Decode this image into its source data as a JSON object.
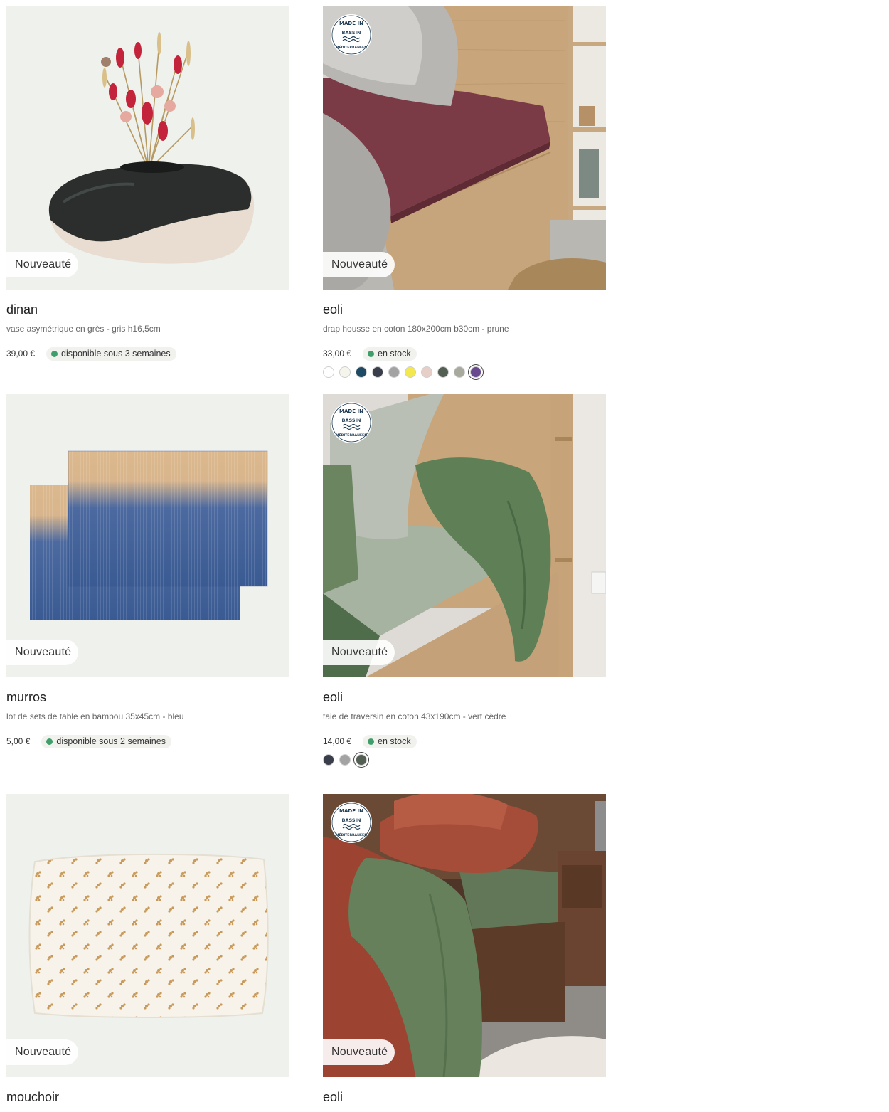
{
  "products": [
    {
      "name": "dinan",
      "description": "vase asymétrique en grès - gris h16,5cm",
      "badge": "Nouveauté",
      "price": "39,00 €",
      "availability": "disponible sous 3 semaines",
      "availability_color": "#3f9f6a",
      "made_in_seal": false,
      "image": "vase-with-dried-flowers",
      "swatches": []
    },
    {
      "name": "eoli",
      "description": "drap housse en coton 180x200cm b30cm - prune",
      "badge": "Nouveauté",
      "price": "33,00 €",
      "availability": "en stock",
      "availability_color": "#3f9f6a",
      "made_in_seal": true,
      "seal_text": [
        "MADE IN",
        "BASSIN",
        "MÉDITERRANÉEN"
      ],
      "image": "bed-fitted-sheet-plum",
      "swatches": [
        {
          "color": "#ffffff",
          "selected": false
        },
        {
          "color": "#f6f5ec",
          "selected": false
        },
        {
          "color": "#1e4a63",
          "selected": false
        },
        {
          "color": "#3a3d4a",
          "selected": false
        },
        {
          "color": "#a3a3a3",
          "selected": false
        },
        {
          "color": "#f3e84e",
          "selected": false
        },
        {
          "color": "#e7cfc8",
          "selected": false
        },
        {
          "color": "#535f52",
          "selected": false
        },
        {
          "color": "#a7aa9c",
          "selected": false
        },
        {
          "color": "#6a4a8f",
          "selected": true
        }
      ]
    },
    {
      "name": "murros",
      "description": "lot de sets de table en bambou 35x45cm - bleu",
      "badge": "Nouveauté",
      "price": "5,00 €",
      "availability": "disponible sous 2 semaines",
      "availability_color": "#3f9f6a",
      "made_in_seal": false,
      "image": "bamboo-placemats-blue",
      "swatches": []
    },
    {
      "name": "eoli",
      "description": "taie de traversin en coton 43x190cm - vert cèdre",
      "badge": "Nouveauté",
      "price": "14,00 €",
      "availability": "en stock",
      "availability_color": "#3f9f6a",
      "made_in_seal": true,
      "seal_text": [
        "MADE IN",
        "BASSIN",
        "MÉDITERRANÉEN"
      ],
      "image": "bed-sheets-cedar-green",
      "swatches": [
        {
          "color": "#3a3d4a",
          "selected": false
        },
        {
          "color": "#a3a3a3",
          "selected": false
        },
        {
          "color": "#535f52",
          "selected": true
        }
      ]
    },
    {
      "name": "mouchoir",
      "description": "",
      "badge": "Nouveauté",
      "made_in_seal": false,
      "image": "floral-pillowcase",
      "swatches": []
    },
    {
      "name": "eoli",
      "description": "",
      "badge": "Nouveauté",
      "made_in_seal": true,
      "seal_text": [
        "MADE IN",
        "BASSIN",
        "MÉDITERRANÉEN"
      ],
      "image": "bed-terracotta-green",
      "swatches": []
    }
  ]
}
